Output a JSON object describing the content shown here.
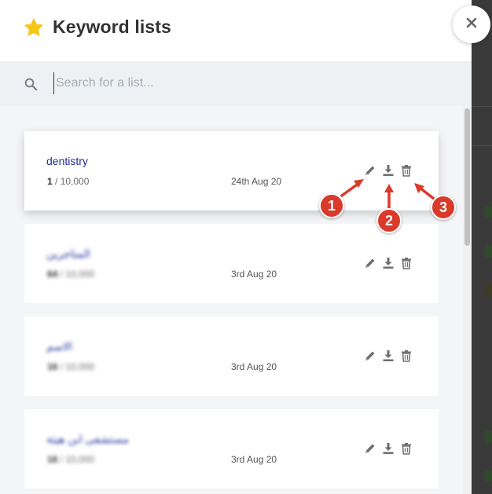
{
  "header": {
    "title": "Keyword lists",
    "star_icon": "star-icon",
    "star_color": "#f5c518"
  },
  "close": {
    "icon": "close-icon"
  },
  "search": {
    "placeholder": "Search for a list...",
    "value": "",
    "icon": "search-icon"
  },
  "lists": [
    {
      "name": "dentistry",
      "count_current": "1",
      "count_suffix": " / 10,000",
      "date": "24th Aug 20",
      "blurred": false
    },
    {
      "name": "المتاجرين",
      "count_current": "64",
      "count_suffix": " / 10,000",
      "date": "3rd Aug 20",
      "blurred": true
    },
    {
      "name": "الاسم",
      "count_current": "16",
      "count_suffix": " / 10,000",
      "date": "3rd Aug 20",
      "blurred": true
    },
    {
      "name": "مستشفى ابن هيثة",
      "count_current": "16",
      "count_suffix": " / 10,000",
      "date": "3rd Aug 20",
      "blurred": true
    }
  ],
  "annotations": [
    {
      "label": "1"
    },
    {
      "label": "2"
    },
    {
      "label": "3"
    }
  ],
  "colors": {
    "link": "#1f2d99",
    "annotation": "#d93a2b",
    "search_bar": "#eef1f4"
  }
}
